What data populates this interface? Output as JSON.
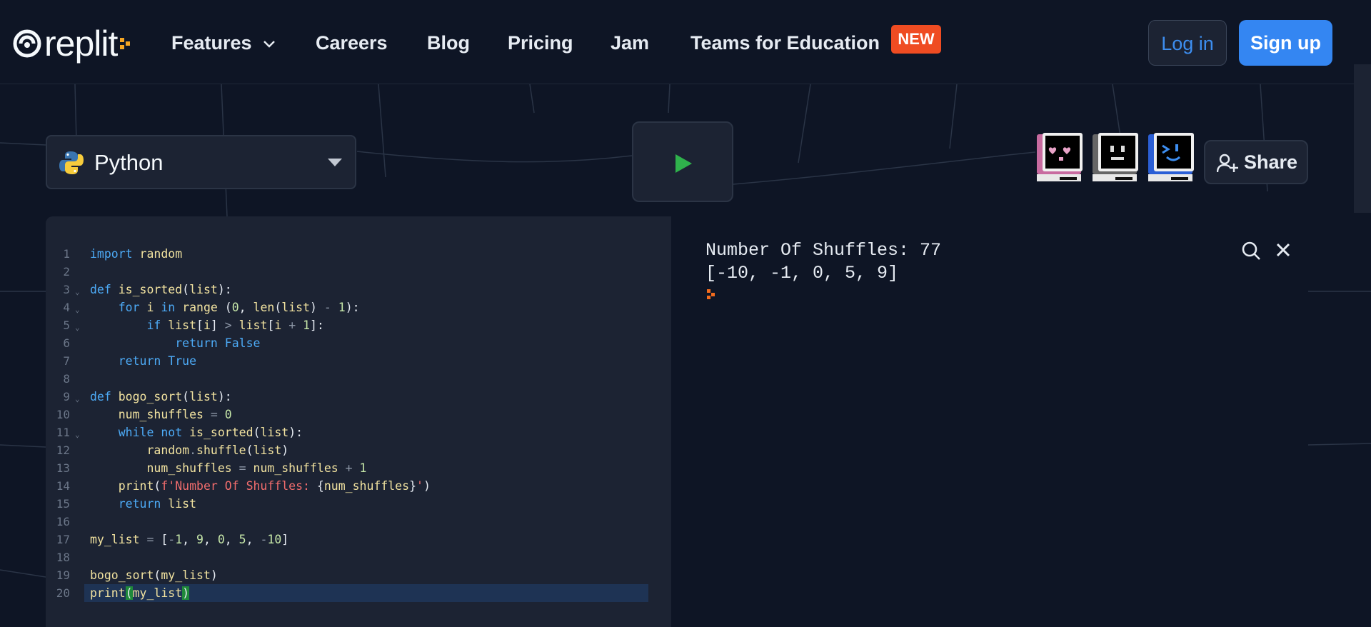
{
  "nav": {
    "logo_text": "replit",
    "links": [
      "Features",
      "Careers",
      "Blog",
      "Pricing",
      "Jam",
      "Teams for Education"
    ],
    "badge": "NEW",
    "login": "Log in",
    "signup": "Sign up"
  },
  "toolbar": {
    "language": "Python",
    "share": "Share"
  },
  "editor": {
    "lines": [
      {
        "n": "1",
        "code": "import random"
      },
      {
        "n": "2",
        "code": ""
      },
      {
        "n": "3",
        "code": "def is_sorted(list):"
      },
      {
        "n": "4",
        "code": "    for i in range (0, len(list) - 1):"
      },
      {
        "n": "5",
        "code": "        if list[i] > list[i + 1]:"
      },
      {
        "n": "6",
        "code": "            return False"
      },
      {
        "n": "7",
        "code": "    return True"
      },
      {
        "n": "8",
        "code": ""
      },
      {
        "n": "9",
        "code": "def bogo_sort(list):"
      },
      {
        "n": "10",
        "code": "    num_shuffles = 0"
      },
      {
        "n": "11",
        "code": "    while not is_sorted(list):"
      },
      {
        "n": "12",
        "code": "        random.shuffle(list)"
      },
      {
        "n": "13",
        "code": "        num_shuffles = num_shuffles + 1"
      },
      {
        "n": "14",
        "code": "    print(f'Number Of Shuffles: {num_shuffles}')"
      },
      {
        "n": "15",
        "code": "    return list"
      },
      {
        "n": "16",
        "code": ""
      },
      {
        "n": "17",
        "code": "my_list = [-1, 9, 0, 5, -10]"
      },
      {
        "n": "18",
        "code": ""
      },
      {
        "n": "19",
        "code": "bogo_sort(my_list)"
      },
      {
        "n": "20",
        "code": "print(my_list)"
      }
    ]
  },
  "console": {
    "line1": "Number Of Shuffles: 77",
    "line2": "[-10, -1, 0, 5, 9]"
  },
  "icons": [
    "replit-logo-icon",
    "chevron-down-icon",
    "python-icon",
    "caret-down-icon",
    "play-icon",
    "avatar-heart-eyes-icon",
    "avatar-neutral-icon",
    "avatar-prompt-icon",
    "add-user-icon",
    "search-icon",
    "close-icon"
  ],
  "colors": {
    "accent": "#3486f2",
    "badge": "#ef4c22",
    "run": "#2fb24c",
    "background": "#0e1525",
    "panel": "#1c2333"
  }
}
